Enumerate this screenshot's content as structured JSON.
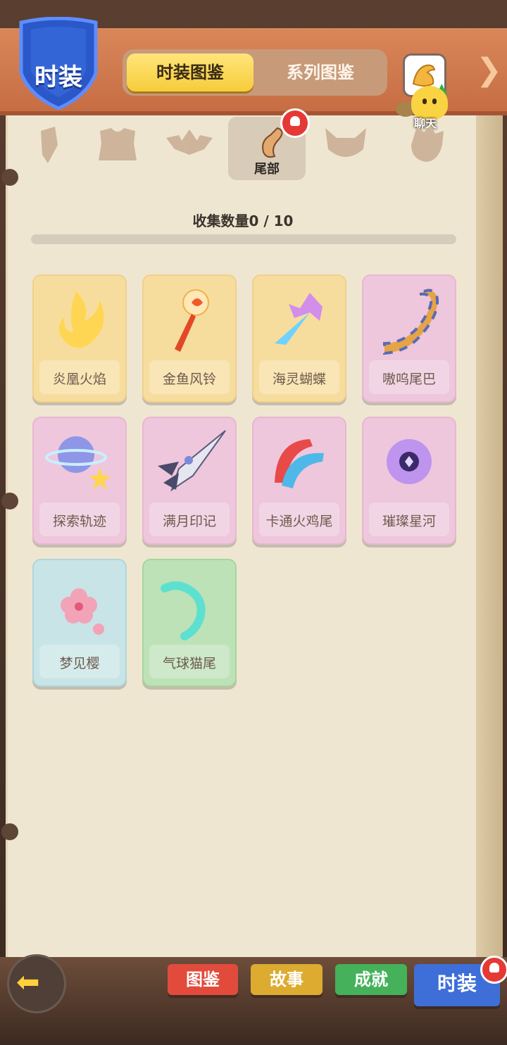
{
  "header": {
    "badge_title": "时装",
    "tabs": [
      "时装图鉴",
      "系列图鉴"
    ],
    "active_tab": "时装图鉴",
    "chat_label": "聊天"
  },
  "categories": [
    {
      "name": "slot-1",
      "label": ""
    },
    {
      "name": "slot-2",
      "label": ""
    },
    {
      "name": "slot-3",
      "label": ""
    },
    {
      "name": "tail",
      "label": "尾部",
      "active": true
    },
    {
      "name": "slot-5",
      "label": ""
    },
    {
      "name": "slot-6",
      "label": ""
    }
  ],
  "collection": {
    "label": "收集数量0 / 10",
    "collected": 0,
    "total": 10
  },
  "items": [
    {
      "name": "炎凰火焰",
      "color": "orange"
    },
    {
      "name": "金鱼风铃",
      "color": "orange"
    },
    {
      "name": "海灵蝴蝶",
      "color": "orange"
    },
    {
      "name": "嗷呜尾巴",
      "color": "pink"
    },
    {
      "name": "探索轨迹",
      "color": "pink"
    },
    {
      "name": "满月印记",
      "color": "pink"
    },
    {
      "name": "卡通火鸡尾",
      "color": "pink"
    },
    {
      "name": "璀璨星河",
      "color": "pink"
    },
    {
      "name": "梦见樱",
      "color": "blue"
    },
    {
      "name": "气球猫尾",
      "color": "green"
    }
  ],
  "bottom_tabs": [
    "图鉴",
    "故事",
    "成就",
    "时装"
  ],
  "accent_colors": {
    "tab_active": "#f6cc3a",
    "badge_blue": "#3e6fd8",
    "notification": "#e53935"
  }
}
